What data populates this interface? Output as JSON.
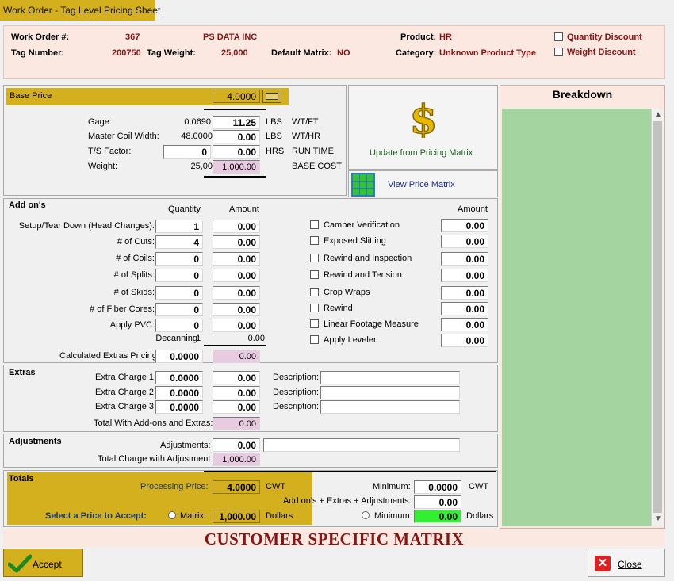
{
  "window": {
    "title": "Work Order - Tag Level Pricing Sheet"
  },
  "header": {
    "work_order_label": "Work Order #:",
    "work_order_value": "367",
    "customer": "PS DATA INC",
    "tag_number_label": "Tag Number:",
    "tag_number_value": "200750",
    "tag_weight_label": "Tag Weight:",
    "tag_weight_value": "25,000",
    "default_matrix_label": "Default Matrix:",
    "default_matrix_value": "NO",
    "product_label": "Product:",
    "product_value": "HR",
    "category_label": "Category:",
    "category_value": "Unknown Product Type",
    "quantity_discount": "Quantity Discount",
    "weight_discount": "Weight Discount"
  },
  "base": {
    "label": "Base Price",
    "value": "4.0000",
    "gage_label": "Gage:",
    "gage_value": "0.0690",
    "gage_amount": "11.25",
    "gage_unit": "LBS",
    "gage_suffix": "WT/FT",
    "mcw_label": "Master Coil Width:",
    "mcw_value": "48.0000",
    "mcw_amount": "0.00",
    "mcw_unit": "LBS",
    "mcw_suffix": "WT/HR",
    "ts_label": "T/S Factor:",
    "ts_value": "0",
    "ts_amount": "0.00",
    "ts_unit": "HRS",
    "ts_suffix": "RUN TIME",
    "weight_label": "Weight:",
    "weight_value": "25,00",
    "weight_amount": "1,000.00",
    "weight_suffix": "BASE COST"
  },
  "pricing_matrix": {
    "update_label": "Update from Pricing Matrix",
    "view_label": "View Price Matrix"
  },
  "breakdown": {
    "title": "Breakdown"
  },
  "addons": {
    "title": "Add on's",
    "quantity_header": "Quantity",
    "amount_header": "Amount",
    "right_amount_header": "Amount",
    "rows": [
      {
        "label": "Setup/Tear Down (Head Changes):",
        "qty": "1",
        "amount": "0.00"
      },
      {
        "label": "# of Cuts:",
        "qty": "4",
        "amount": "0.00"
      },
      {
        "label": "# of Coils:",
        "qty": "0",
        "amount": "0.00"
      },
      {
        "label": "# of Splits:",
        "qty": "0",
        "amount": "0.00"
      },
      {
        "label": "# of Skids:",
        "qty": "0",
        "amount": "0.00"
      },
      {
        "label": "# of Fiber Cores:",
        "qty": "0",
        "amount": "0.00"
      },
      {
        "label": "Apply PVC:",
        "qty": "0",
        "amount": "0.00"
      }
    ],
    "decanning_label": "Decanning:",
    "decanning_qty": "1",
    "decanning_amount": "0.00",
    "calc_label": "Calculated Extras Pricing:",
    "calc_value": "0.0000",
    "calc_amount": "0.00",
    "options": [
      {
        "label": "Camber Verification",
        "amount": "0.00"
      },
      {
        "label": "Exposed Slitting",
        "amount": "0.00"
      },
      {
        "label": "Rewind and Inspection",
        "amount": "0.00"
      },
      {
        "label": "Rewind and Tension",
        "amount": "0.00"
      },
      {
        "label": "Crop Wraps",
        "amount": "0.00"
      },
      {
        "label": "Rewind",
        "amount": "0.00"
      },
      {
        "label": "Linear Footage Measure",
        "amount": "0.00"
      },
      {
        "label": "Apply Leveler",
        "amount": "0.00"
      }
    ]
  },
  "extras": {
    "title": "Extras",
    "rows": [
      {
        "label": "Extra Charge 1:",
        "value": "0.0000",
        "amount": "0.00",
        "desc_label": "Description:",
        "desc": ""
      },
      {
        "label": "Extra Charge 2:",
        "value": "0.0000",
        "amount": "0.00",
        "desc_label": "Description:",
        "desc": ""
      },
      {
        "label": "Extra Charge 3:",
        "value": "0.0000",
        "amount": "0.00",
        "desc_label": "Description:",
        "desc": ""
      }
    ],
    "total_label": "Total With Add-ons and Extras:",
    "total_value": "0.00"
  },
  "adjustments": {
    "title": "Adjustments",
    "label": "Adjustments:",
    "value": "0.00",
    "note": "",
    "total_label": "Total Charge with Adjustment",
    "total_value": "1,000.00"
  },
  "totals": {
    "title": "Totals",
    "processing_label": "Processing Price:",
    "processing_value": "4.0000",
    "processing_unit": "CWT",
    "minimum_label": "Minimum:",
    "minimum_value": "0.0000",
    "minimum_unit": "CWT",
    "addons_label": "Add on's + Extras + Adjustments:",
    "addons_value": "0.00",
    "select_label": "Select a Price to Accept:",
    "matrix_radio_label": "Matrix:",
    "matrix_value": "1,000.00",
    "matrix_unit": "Dollars",
    "minimum_radio_label": "Minimum:",
    "minimum_dollars": "0.00",
    "minimum_dollars_unit": "Dollars"
  },
  "banner": "CUSTOMER SPECIFIC MATRIX",
  "footer": {
    "accept_label": "Accept",
    "close_label": "Close"
  },
  "colors": {
    "gold": "#d4b01e",
    "dark_red": "#8a1414",
    "breakdown_green": "#a4d4a0",
    "header_pink": "#fbe9e1"
  }
}
